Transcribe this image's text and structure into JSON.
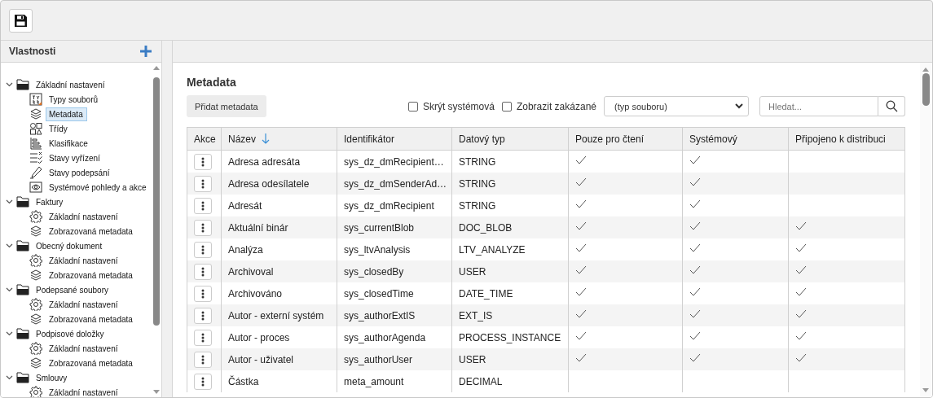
{
  "sidebar": {
    "title": "Vlastnosti",
    "tree": [
      {
        "label": "Základní nastavení",
        "expanded": true,
        "children": [
          {
            "label": "Typy souborů",
            "kind": "filetypes",
            "selected": false
          },
          {
            "label": "Metadata",
            "kind": "layers",
            "selected": true
          },
          {
            "label": "Třídy",
            "kind": "shapes",
            "selected": false
          },
          {
            "label": "Klasifikace",
            "kind": "classification",
            "selected": false
          },
          {
            "label": "Stavy vyřízení",
            "kind": "states",
            "selected": false
          },
          {
            "label": "Stavy podepsání",
            "kind": "pen",
            "selected": false
          },
          {
            "label": "Systémové pohledy a akce",
            "kind": "eye",
            "selected": false
          }
        ]
      },
      {
        "label": "Faktury",
        "expanded": true,
        "children": [
          {
            "label": "Základní nastavení",
            "kind": "gear",
            "selected": false
          },
          {
            "label": "Zobrazovaná metadata",
            "kind": "layers",
            "selected": false
          }
        ]
      },
      {
        "label": "Obecný dokument",
        "expanded": true,
        "children": [
          {
            "label": "Základní nastavení",
            "kind": "gear",
            "selected": false
          },
          {
            "label": "Zobrazovaná metadata",
            "kind": "layers",
            "selected": false
          }
        ]
      },
      {
        "label": "Podepsané soubory",
        "expanded": true,
        "children": [
          {
            "label": "Základní nastavení",
            "kind": "gear",
            "selected": false
          },
          {
            "label": "Zobrazovaná metadata",
            "kind": "layers",
            "selected": false
          }
        ]
      },
      {
        "label": "Podpisové doložky",
        "expanded": true,
        "children": [
          {
            "label": "Základní nastavení",
            "kind": "gear",
            "selected": false
          },
          {
            "label": "Zobrazovaná metadata",
            "kind": "layers",
            "selected": false
          }
        ]
      },
      {
        "label": "Smlouvy",
        "expanded": true,
        "children": [
          {
            "label": "Základní nastavení",
            "kind": "gear",
            "selected": false
          }
        ]
      }
    ]
  },
  "main": {
    "title": "Metadata",
    "add_button": "Přidat metadata",
    "filters": [
      {
        "label": "Skrýt systémová",
        "checked": false
      },
      {
        "label": "Zobrazit zakázané",
        "checked": false
      }
    ],
    "file_type_select": {
      "value": "(typ souboru)"
    },
    "search": {
      "placeholder": "Hledat..."
    },
    "table": {
      "columns": [
        {
          "label": "Akce",
          "sorted": false
        },
        {
          "label": "Název",
          "sorted": true
        },
        {
          "label": "Identifikátor",
          "sorted": false
        },
        {
          "label": "Datový typ",
          "sorted": false
        },
        {
          "label": "Pouze pro čtení",
          "sorted": false
        },
        {
          "label": "Systémový",
          "sorted": false
        },
        {
          "label": "Připojeno k distribuci",
          "sorted": false
        }
      ],
      "rows": [
        {
          "name": "Adresa adresáta",
          "id": "sys_dz_dmRecipient…",
          "type": "STRING",
          "read_only": true,
          "system": true,
          "distributed": false
        },
        {
          "name": "Adresa odesílatele",
          "id": "sys_dz_dmSenderAd…",
          "type": "STRING",
          "read_only": true,
          "system": true,
          "distributed": false
        },
        {
          "name": "Adresát",
          "id": "sys_dz_dmRecipient",
          "type": "STRING",
          "read_only": true,
          "system": true,
          "distributed": false
        },
        {
          "name": "Aktuální binár",
          "id": "sys_currentBlob",
          "type": "DOC_BLOB",
          "read_only": true,
          "system": true,
          "distributed": true
        },
        {
          "name": "Analýza",
          "id": "sys_ltvAnalysis",
          "type": "LTV_ANALYZE",
          "read_only": true,
          "system": true,
          "distributed": true
        },
        {
          "name": "Archivoval",
          "id": "sys_closedBy",
          "type": "USER",
          "read_only": true,
          "system": true,
          "distributed": true
        },
        {
          "name": "Archivováno",
          "id": "sys_closedTime",
          "type": "DATE_TIME",
          "read_only": true,
          "system": true,
          "distributed": true
        },
        {
          "name": "Autor - externí systém",
          "id": "sys_authorExtIS",
          "type": "EXT_IS",
          "read_only": true,
          "system": true,
          "distributed": true
        },
        {
          "name": "Autor - proces",
          "id": "sys_authorAgenda",
          "type": "PROCESS_INSTANCE",
          "read_only": true,
          "system": true,
          "distributed": true
        },
        {
          "name": "Autor - uživatel",
          "id": "sys_authorUser",
          "type": "USER",
          "read_only": true,
          "system": true,
          "distributed": true
        },
        {
          "name": "Částka",
          "id": "meta_amount",
          "type": "DECIMAL",
          "read_only": false,
          "system": false,
          "distributed": false
        }
      ]
    }
  }
}
